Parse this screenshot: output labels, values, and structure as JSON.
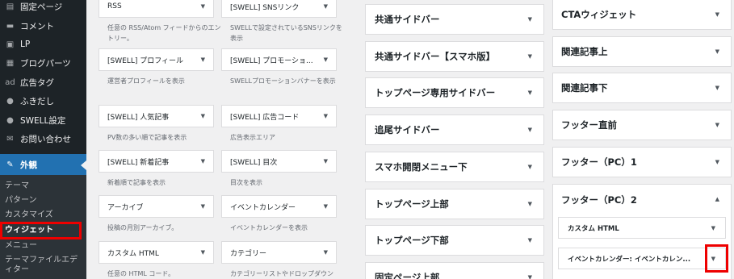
{
  "sidebar": {
    "items": [
      {
        "label": "固定ページ",
        "icon": "page-icon",
        "glyph": "▤"
      },
      {
        "label": "コメント",
        "icon": "comment-icon",
        "glyph": "▬"
      },
      {
        "label": "LP",
        "icon": "lp-icon",
        "glyph": "▣"
      },
      {
        "label": "ブログパーツ",
        "icon": "blog-parts-icon",
        "glyph": "▦"
      },
      {
        "label": "広告タグ",
        "icon": "ad-tag-icon",
        "glyph": "ad"
      },
      {
        "label": "ふきだし",
        "icon": "balloon-icon",
        "glyph": "●"
      },
      {
        "label": "SWELL設定",
        "icon": "swell-settings-icon",
        "glyph": "●"
      },
      {
        "label": "お問い合わせ",
        "icon": "mail-icon",
        "glyph": "✉"
      }
    ],
    "active": {
      "label": "外観",
      "icon": "appearance-icon",
      "glyph": "✎"
    },
    "submenu": [
      "テーマ",
      "パターン",
      "カスタマイズ",
      "ウィジェット",
      "メニュー",
      "テーマファイルエディター"
    ],
    "current_submenu": "ウィジェット"
  },
  "available_widgets": [
    {
      "left": {
        "title": "RSS",
        "desc": "任意の RSS/Atom フィードからのエントリー。"
      },
      "right": {
        "title": "[SWELL] SNSリンク",
        "desc": "SWELLで設定されているSNSリンクを表示"
      }
    },
    {
      "left": {
        "title": "[SWELL] プロフィール",
        "desc": "運営者プロフィールを表示"
      },
      "right": {
        "title": "[SWELL] プロモーショ...",
        "desc": "SWELLプロモーションバナーを表示"
      }
    },
    {
      "left": {
        "title": "[SWELL] 人気記事",
        "desc": "PV数の多い順で記事を表示"
      },
      "right": {
        "title": "[SWELL] 広告コード",
        "desc": "広告表示エリア"
      }
    },
    {
      "left": {
        "title": "[SWELL] 新着記事",
        "desc": "新着順で記事を表示"
      },
      "right": {
        "title": "[SWELL] 目次",
        "desc": "目次を表示"
      }
    },
    {
      "left": {
        "title": "アーカイブ",
        "desc": "投稿の月別アーカイブ。"
      },
      "right": {
        "title": "イベントカレンダー",
        "desc": "イベントカレンダーを表示"
      }
    },
    {
      "left": {
        "title": "カスタム HTML",
        "desc": "任意の HTML コード。"
      },
      "right": {
        "title": "カテゴリー",
        "desc": "カテゴリーリストやドロップダウン"
      }
    }
  ],
  "sidebar_areas": [
    "共通サイドバー",
    "共通サイドバー【スマホ版】",
    "トップページ専用サイドバー",
    "追尾サイドバー",
    "スマホ開閉メニュー下",
    "トップページ上部",
    "トップページ下部",
    "固定ページ上部"
  ],
  "right_areas": [
    "CTAウィジェット",
    "関連記事上",
    "関連記事下",
    "フッター直前",
    "フッター（PC）1"
  ],
  "open_area": {
    "title": "フッター（PC）2",
    "widgets": [
      "カスタム HTML",
      "イベントカレンダー: イベントカレン..."
    ]
  },
  "glyphs": {
    "collapse": "▼",
    "expand": "▲"
  }
}
